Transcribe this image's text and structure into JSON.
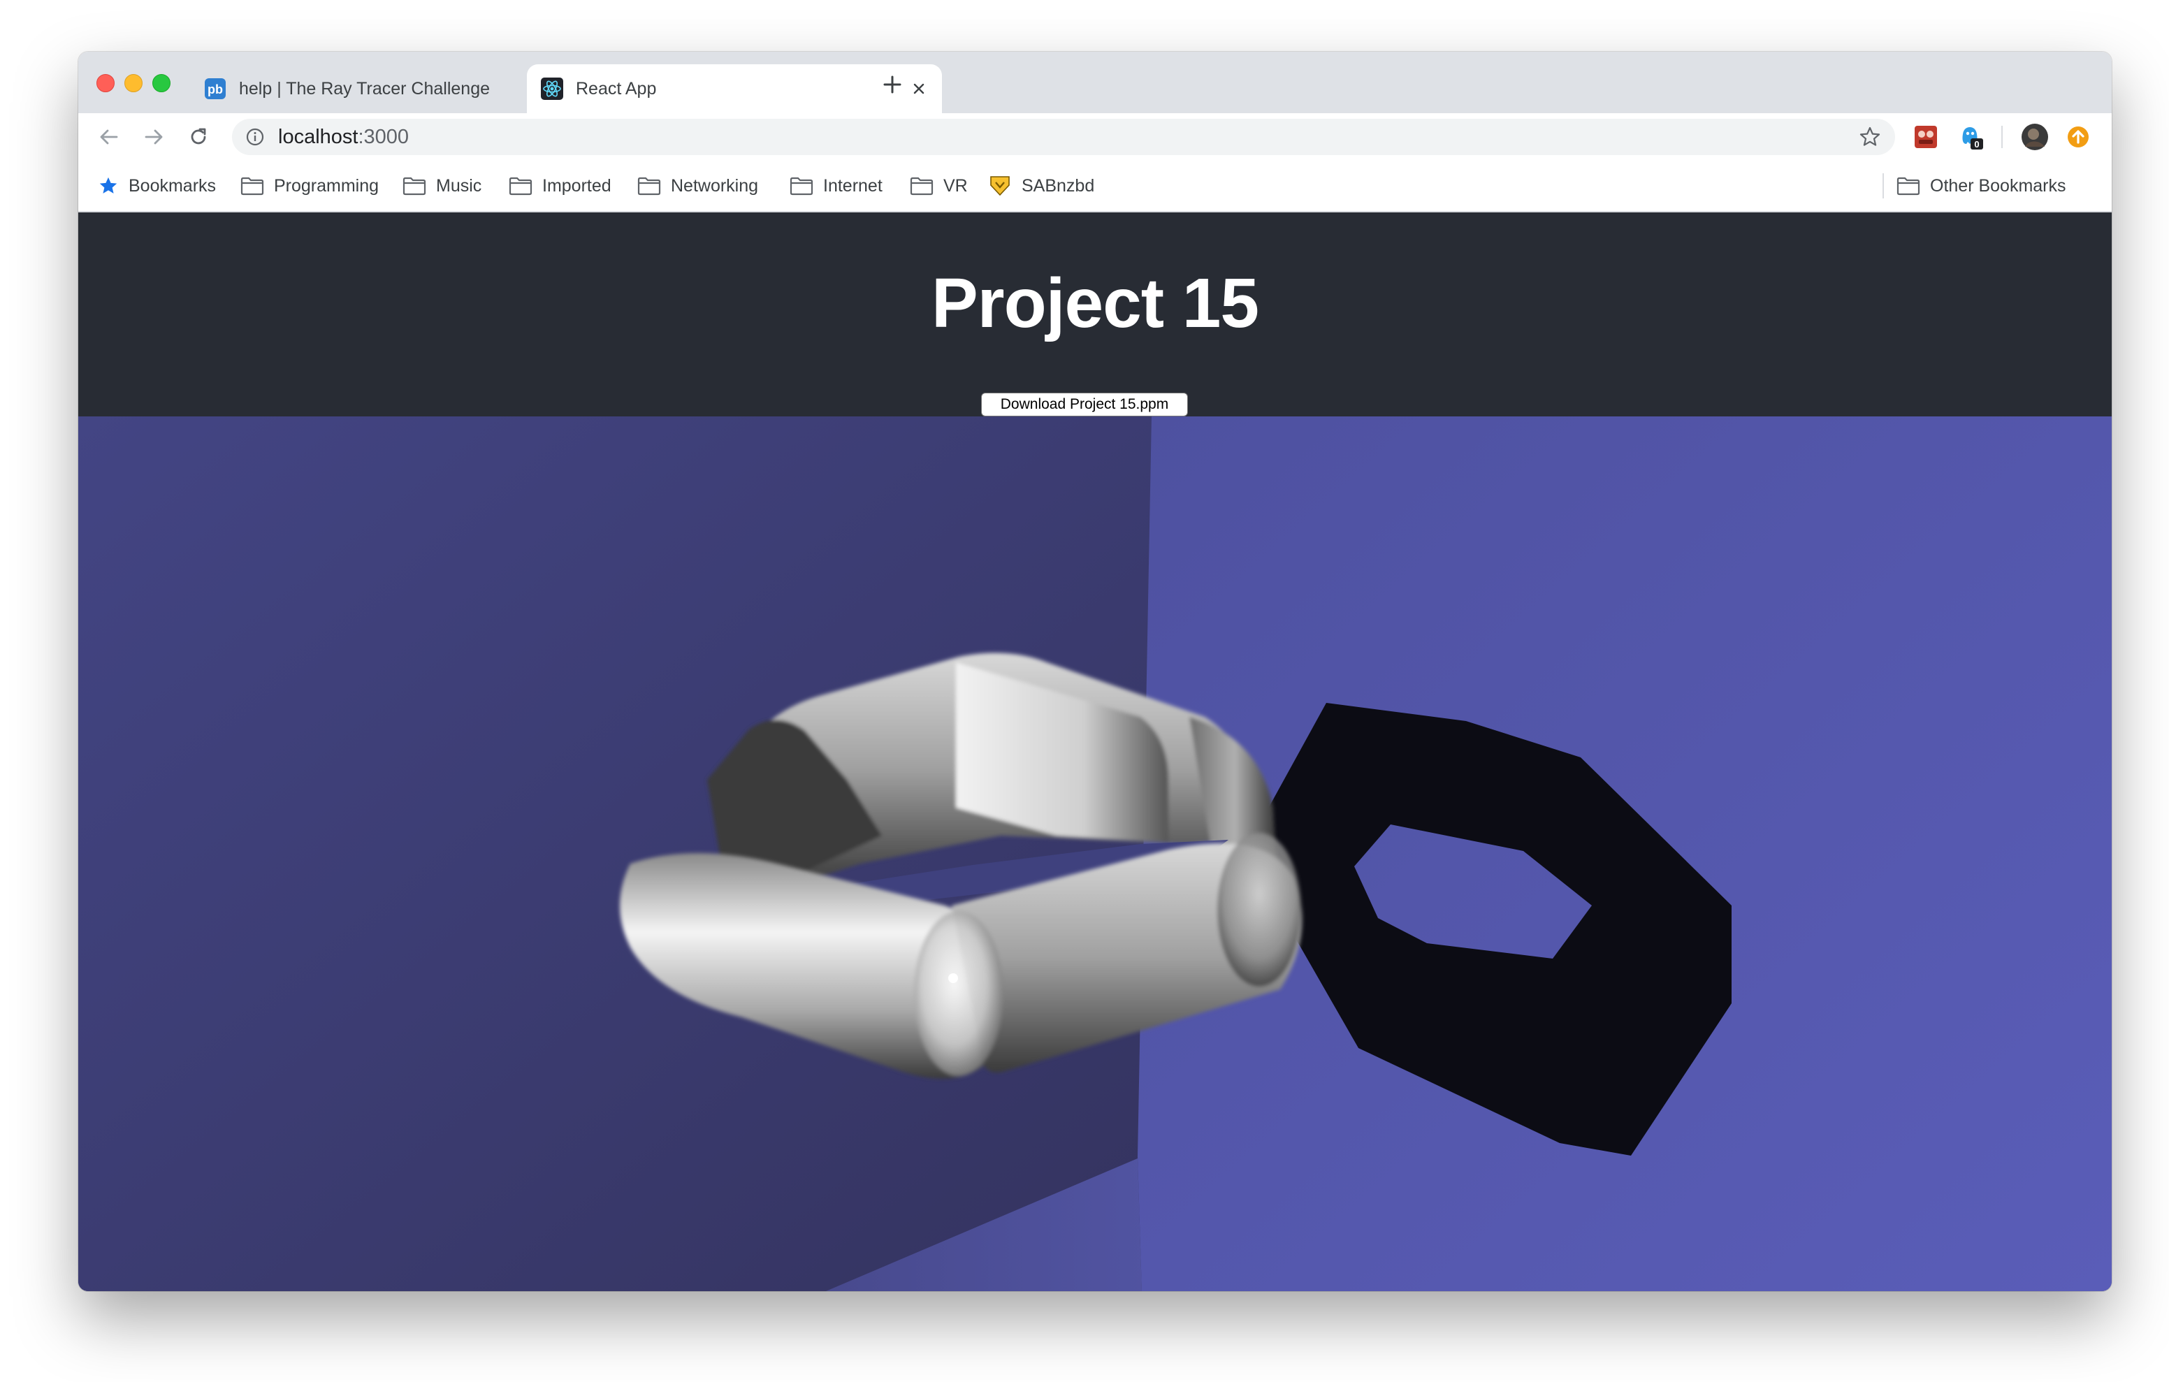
{
  "browser": {
    "tabs": [
      {
        "title": "help | The Ray Tracer Challenge",
        "active": false,
        "icon": "pb-favicon"
      },
      {
        "title": "React App",
        "active": true,
        "icon": "react-favicon"
      }
    ],
    "address": {
      "host": "localhost",
      "port": ":3000"
    },
    "extensions": [
      {
        "icon": "red-extension-icon"
      },
      {
        "icon": "ghostery-icon",
        "badge": "0"
      },
      {
        "icon": "profile-avatar"
      },
      {
        "icon": "update-icon"
      }
    ]
  },
  "bookmarks": {
    "items": [
      {
        "label": "Bookmarks",
        "icon": "star-icon"
      },
      {
        "label": "Programming",
        "icon": "folder-icon"
      },
      {
        "label": "Music",
        "icon": "folder-icon"
      },
      {
        "label": "Imported",
        "icon": "folder-icon"
      },
      {
        "label": "Networking",
        "icon": "folder-icon"
      },
      {
        "label": "Internet",
        "icon": "folder-icon"
      },
      {
        "label": "VR",
        "icon": "folder-icon"
      },
      {
        "label": "SABnzbd",
        "icon": "sabnzbd-icon"
      }
    ],
    "other": {
      "label": "Other Bookmarks",
      "icon": "folder-icon"
    }
  },
  "page": {
    "title": "Project 15",
    "download_label": "Download Project 15.ppm"
  },
  "colors": {
    "header_bg": "#282c34",
    "scene_wall": "#4e519c",
    "scene_wall_dark": "#3d3d7a",
    "traffic_red": "#ff5f57",
    "traffic_yellow": "#febc2e",
    "traffic_green": "#28c840"
  }
}
